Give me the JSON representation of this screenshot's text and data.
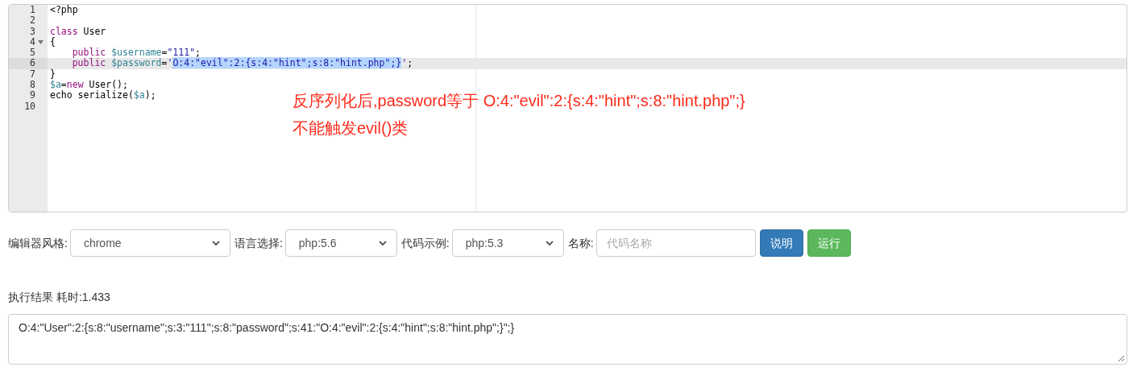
{
  "editor": {
    "lines": [
      {
        "number": "1",
        "active": false,
        "foldable": false,
        "tokens": [
          {
            "text": "<?php",
            "kind": "plain",
            "selected": false
          }
        ]
      },
      {
        "number": "2",
        "active": false,
        "foldable": false
      },
      {
        "number": "3",
        "active": false,
        "foldable": false,
        "tokens": [
          {
            "text": "class",
            "kind": "keyword",
            "selected": false
          },
          {
            "text": " User",
            "kind": "plain",
            "selected": false
          }
        ]
      },
      {
        "number": "4",
        "active": false,
        "foldable": true,
        "tokens": [
          {
            "text": "{",
            "kind": "plain",
            "selected": false
          }
        ]
      },
      {
        "number": "5",
        "active": false,
        "foldable": false,
        "tokens": [
          {
            "text": "    public",
            "kind": "keyword",
            "selected": false
          },
          {
            "text": " $username",
            "kind": "variable",
            "selected": false
          },
          {
            "text": "=",
            "kind": "plain",
            "selected": false
          },
          {
            "text": "\"111\"",
            "kind": "string",
            "selected": false
          },
          {
            "text": ";",
            "kind": "plain",
            "selected": false
          }
        ]
      },
      {
        "number": "6",
        "active": true,
        "foldable": false,
        "tokens": [
          {
            "text": "    public",
            "kind": "keyword",
            "selected": false
          },
          {
            "text": " $password",
            "kind": "variable",
            "selected": false
          },
          {
            "text": "=",
            "kind": "plain",
            "selected": false
          },
          {
            "text": "'",
            "kind": "string",
            "selected": false
          },
          {
            "text": "O:4:\"evil\":2:{s:4:\"hint\";s:8:\"hint.php\";}",
            "kind": "string",
            "selected": true
          },
          {
            "text": "'",
            "kind": "string",
            "selected": false
          },
          {
            "text": ";",
            "kind": "plain",
            "selected": false
          }
        ]
      },
      {
        "number": "7",
        "active": false,
        "foldable": false,
        "tokens": [
          {
            "text": "}",
            "kind": "plain",
            "selected": false
          }
        ]
      },
      {
        "number": "8",
        "active": false,
        "foldable": false,
        "tokens": [
          {
            "text": "$a",
            "kind": "variable",
            "selected": false
          },
          {
            "text": "=",
            "kind": "plain",
            "selected": false
          },
          {
            "text": "new",
            "kind": "keyword",
            "selected": false
          },
          {
            "text": " User();",
            "kind": "plain",
            "selected": false
          }
        ]
      },
      {
        "number": "9",
        "active": false,
        "foldable": false,
        "tokens": [
          {
            "text": "echo serialize(",
            "kind": "plain",
            "selected": false
          },
          {
            "text": "$a",
            "kind": "variable",
            "selected": false
          },
          {
            "text": ");",
            "kind": "plain",
            "selected": false
          }
        ]
      },
      {
        "number": "10",
        "active": false,
        "foldable": false
      }
    ],
    "annotation": [
      "反序列化后,password等于 O:4:\"evil\":2:{s:4:\"hint\";s:8:\"hint.php\";}",
      "不能触发evil()类"
    ]
  },
  "toolbar": {
    "editor_style": {
      "label": "编辑器风格:",
      "value": "chrome"
    },
    "language": {
      "label": "语言选择:",
      "value": "php:5.6"
    },
    "example": {
      "label": "代码示例:",
      "value": "php:5.3"
    },
    "name": {
      "label": "名称:",
      "placeholder": "代码名称"
    },
    "buttons": [
      {
        "label": "说明",
        "kind": "info"
      },
      {
        "label": "运行",
        "kind": "success"
      }
    ]
  },
  "result": {
    "label": "执行结果 耗时:1.433",
    "output": "O:4:\"User\":2:{s:8:\"username\";s:3:\"111\";s:8:\"password\";s:41:\"O:4:\"evil\":2:{s:4:\"hint\";s:8:\"hint.php\";}\";}"
  }
}
